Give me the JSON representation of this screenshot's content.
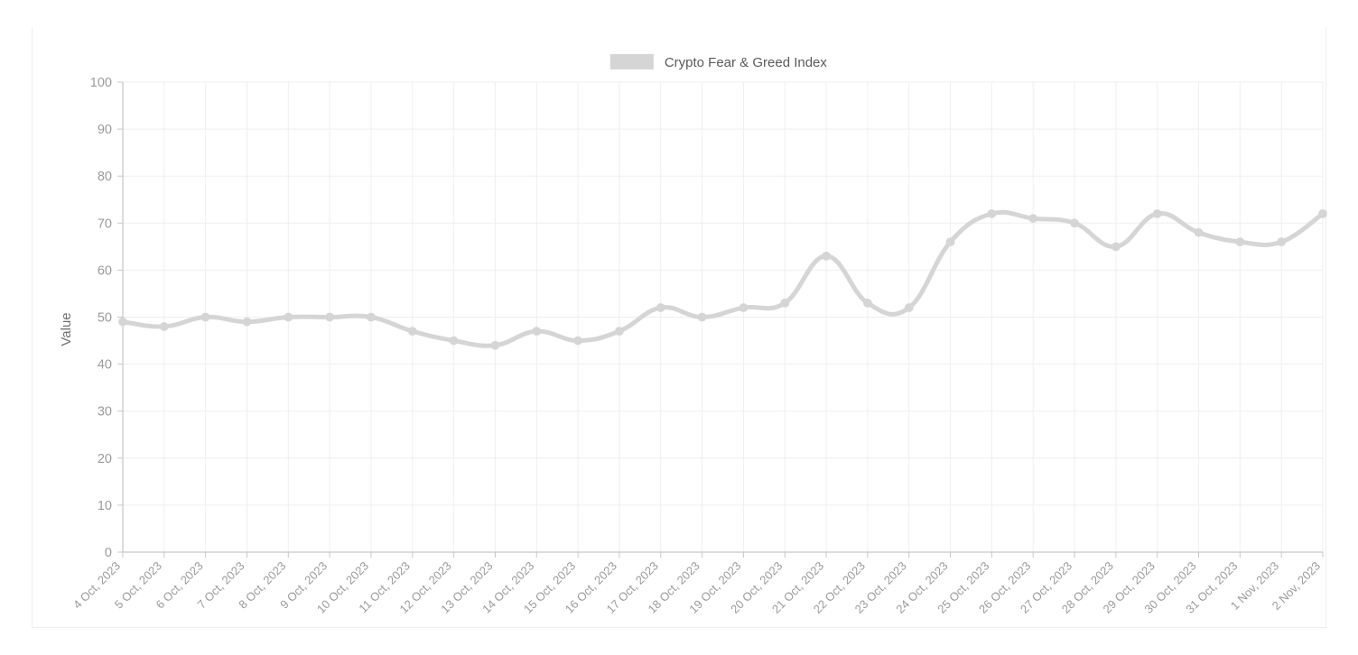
{
  "legend": {
    "position": "top",
    "entries": [
      {
        "label": "Crypto Fear & Greed Index",
        "color": "#d5d5d5"
      }
    ]
  },
  "axes": {
    "y_title": "Value",
    "y_ticks": [
      "0",
      "10",
      "20",
      "30",
      "40",
      "50",
      "60",
      "70",
      "80",
      "90",
      "100"
    ],
    "x_ticks": [
      "4 Oct, 2023",
      "5 Oct, 2023",
      "6 Oct, 2023",
      "7 Oct, 2023",
      "8 Oct, 2023",
      "9 Oct, 2023",
      "10 Oct, 2023",
      "11 Oct, 2023",
      "12 Oct, 2023",
      "13 Oct, 2023",
      "14 Oct, 2023",
      "15 Oct, 2023",
      "16 Oct, 2023",
      "17 Oct, 2023",
      "18 Oct, 2023",
      "19 Oct, 2023",
      "20 Oct, 2023",
      "21 Oct, 2023",
      "22 Oct, 2023",
      "23 Oct, 2023",
      "24 Oct, 2023",
      "25 Oct, 2023",
      "26 Oct, 2023",
      "27 Oct, 2023",
      "28 Oct, 2023",
      "29 Oct, 2023",
      "30 Oct, 2023",
      "31 Oct, 2023",
      "1 Nov, 2023",
      "2 Nov, 2023"
    ]
  },
  "colors": {
    "series": "#d5d5d5",
    "grid": "#efefef",
    "axis": "#c8c8c8",
    "tick_text": "#9a9a9a",
    "legend_text": "#5a5a5a",
    "card_border": "#ededed",
    "background": "#ffffff"
  },
  "chart_data": {
    "type": "line",
    "title": "",
    "xlabel": "",
    "ylabel": "Value",
    "ylim": [
      0,
      100
    ],
    "ytick_step": 10,
    "grid": true,
    "legend_position": "top",
    "smooth": true,
    "markers": true,
    "categories": [
      "4 Oct, 2023",
      "5 Oct, 2023",
      "6 Oct, 2023",
      "7 Oct, 2023",
      "8 Oct, 2023",
      "9 Oct, 2023",
      "10 Oct, 2023",
      "11 Oct, 2023",
      "12 Oct, 2023",
      "13 Oct, 2023",
      "14 Oct, 2023",
      "15 Oct, 2023",
      "16 Oct, 2023",
      "17 Oct, 2023",
      "18 Oct, 2023",
      "19 Oct, 2023",
      "20 Oct, 2023",
      "21 Oct, 2023",
      "22 Oct, 2023",
      "23 Oct, 2023",
      "24 Oct, 2023",
      "25 Oct, 2023",
      "26 Oct, 2023",
      "27 Oct, 2023",
      "28 Oct, 2023",
      "29 Oct, 2023",
      "30 Oct, 2023",
      "31 Oct, 2023",
      "1 Nov, 2023",
      "2 Nov, 2023"
    ],
    "series": [
      {
        "name": "Crypto Fear & Greed Index",
        "color": "#d5d5d5",
        "values": [
          49,
          48,
          50,
          49,
          50,
          50,
          50,
          47,
          45,
          44,
          47,
          45,
          47,
          52,
          50,
          52,
          53,
          63,
          53,
          52,
          66,
          72,
          71,
          70,
          65,
          72,
          68,
          66,
          66,
          72
        ]
      }
    ]
  }
}
